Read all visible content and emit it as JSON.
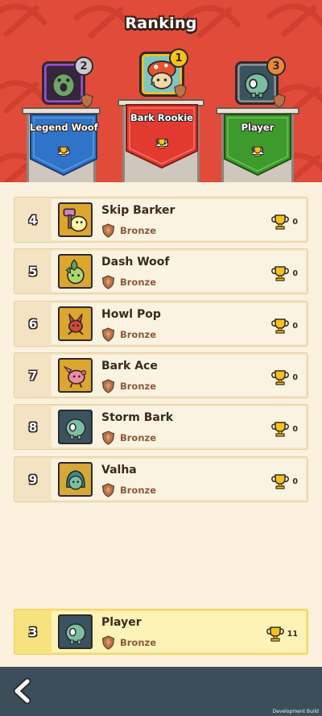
{
  "title": "Ranking",
  "colors": {
    "header_red": "#e14c3a",
    "list_background": "#faf2de",
    "row_background": "#f4e3c3",
    "player_row_highlight": "#f6e27e",
    "bottom_bar": "#3d4e5b",
    "gold": "#f5c21b",
    "bronze": "#b87447"
  },
  "podium": [
    {
      "place": "1",
      "name": "Bark Rookie",
      "score": "18",
      "banner_color": "#e23a2e",
      "frame_color": "#f5c21b",
      "avatar_icon": "mushroom-cat-avatar-icon"
    },
    {
      "place": "2",
      "name": "Legend Woof",
      "score": "15",
      "banner_color": "#2f74c9",
      "frame_color": "#9a4fd0",
      "avatar_icon": "green-blob-avatar-icon"
    },
    {
      "place": "3",
      "name": "Player",
      "score": "11",
      "banner_color": "#3d9a2c",
      "frame_color": "#8d8f94",
      "avatar_icon": "zombie-blob-avatar-icon"
    }
  ],
  "ranking_list": [
    {
      "rank": "4",
      "name": "Skip Barker",
      "tier": "Bronze",
      "score": "0",
      "avatar_icon": "hammer-creature-avatar-icon"
    },
    {
      "rank": "5",
      "name": "Dash Woof",
      "tier": "Bronze",
      "score": "0",
      "avatar_icon": "leaf-creature-avatar-icon"
    },
    {
      "rank": "6",
      "name": "Howl Pop",
      "tier": "Bronze",
      "score": "0",
      "avatar_icon": "red-fox-avatar-icon"
    },
    {
      "rank": "7",
      "name": "Bark Ace",
      "tier": "Bronze",
      "score": "0",
      "avatar_icon": "pink-pig-avatar-icon"
    },
    {
      "rank": "8",
      "name": "Storm Bark",
      "tier": "Bronze",
      "score": "0",
      "avatar_icon": "teal-blob-avatar-icon"
    },
    {
      "rank": "9",
      "name": "Valha",
      "tier": "Bronze",
      "score": "0",
      "avatar_icon": "hooded-blob-avatar-icon"
    }
  ],
  "player_row": {
    "rank": "3",
    "name": "Player",
    "tier": "Bronze",
    "score": "11",
    "avatar_icon": "zombie-blob-avatar-icon"
  },
  "icons": {
    "trophy": "trophy-icon",
    "tier": "bronze-shield-icon",
    "back": "back-arrow-icon"
  },
  "footer": {
    "build_label": "Development Build"
  }
}
